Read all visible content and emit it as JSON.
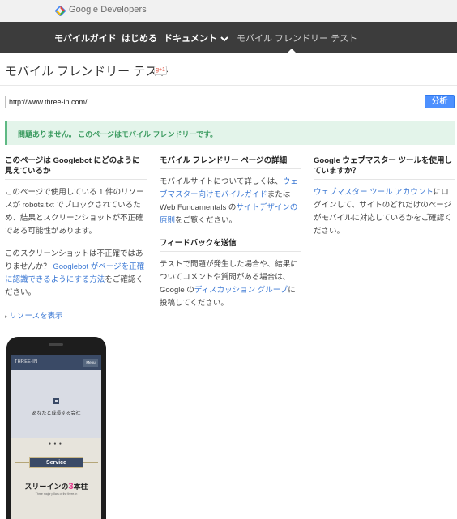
{
  "brand": {
    "name": "Google Developers",
    "logo_icon": "google-developers-logo-icon"
  },
  "nav": {
    "items": [
      {
        "label": "モバイルガイド"
      },
      {
        "label": "はじめる"
      },
      {
        "label": "ドキュメント"
      },
      {
        "label": "モバイル フレンドリー テスト"
      }
    ]
  },
  "page": {
    "title": "モバイル フレンドリー テスト",
    "gplus": "g+1"
  },
  "url_form": {
    "value": "http://www.three-in.com/",
    "button": "分析"
  },
  "result": {
    "message": "問題ありません。 このページはモバイル フレンドリーです。"
  },
  "col1": {
    "heading": "このページは Googlebot にどのように見えているか",
    "p1": "このページで使用している 1 件のリソースが robots.txt でブロックされているため、結果とスクリーンショットが不正確である可能性があります。",
    "p2_before": "このスクリーンショットは不正確ではありませんか？ ",
    "p2_link": "Googlebot がページを正確に認識できるようにする方法",
    "p2_after": "をご確認ください。",
    "resource_link": "リソースを表示"
  },
  "col2": {
    "heading": "モバイル フレンドリー ページの詳細",
    "p1_before": "モバイルサイトについて詳しくは、",
    "p1_link1": "ウェブマスター向けモバイルガイド",
    "p1_mid": "または Web Fundamentals の",
    "p1_link2": "サイトデザインの原則",
    "p1_after": "をご覧ください。",
    "heading2": "フィードバックを送信",
    "p2_before": "テストで問題が発生した場合や、結果についてコメントや質問がある場合は、Google の",
    "p2_link": "ディスカッション グループ",
    "p2_after": "に投稿してください。"
  },
  "col3": {
    "heading": "Google ウェブマスター ツールを使用していますか？",
    "p1_link": "ウェブマスター ツール アカウント",
    "p1_after": "にログインして、サイトのどれだけのページがモバイルに対応しているかをご確認ください。"
  },
  "screenshot": {
    "logo": "THREE-IN",
    "menu": "Menu",
    "hero_text": "あなたと成長する会社",
    "dots": "● ● ●",
    "service": "Service",
    "pillar_prefix": "スリーインの",
    "pillar_num": "3",
    "pillar_suffix": "本柱",
    "pillar_sub": "Three major pillars of the three-in"
  },
  "colors": {
    "nav_bg": "#3c3c3c",
    "accent_blue": "#4d90fe",
    "success_bg": "#e3f4ea",
    "success_text": "#3a9a5f"
  }
}
